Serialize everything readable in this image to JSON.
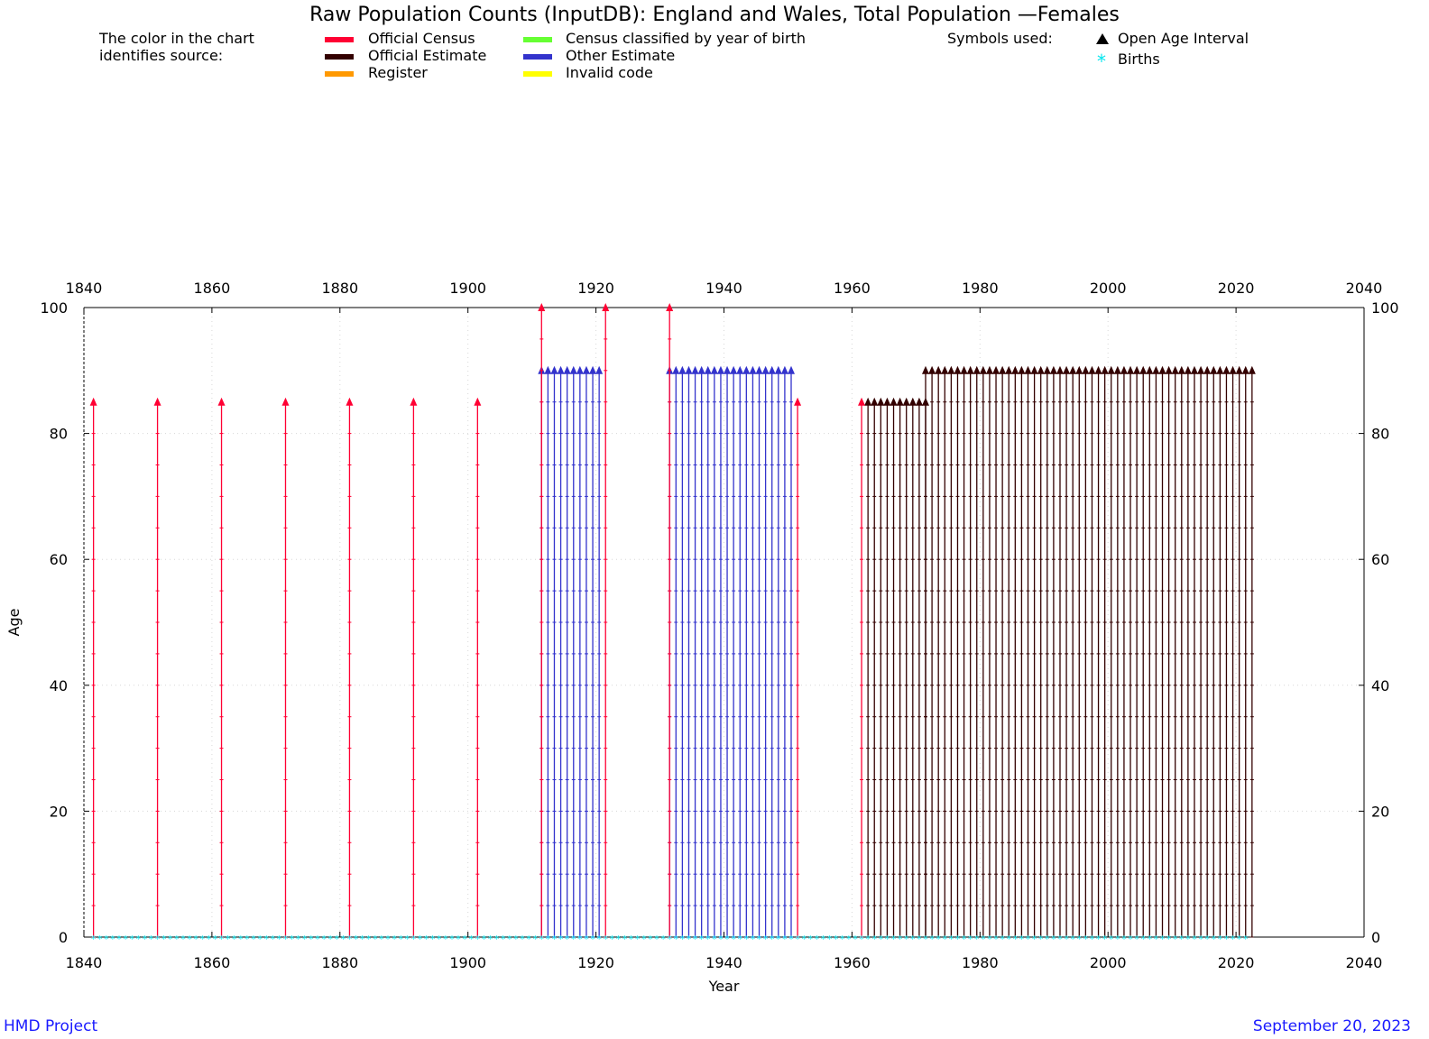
{
  "title": "Raw Population Counts (InputDB): England and Wales, Total Population  —Females",
  "legend": {
    "intro_line1": "The color in the chart",
    "intro_line2": "identifies source:",
    "sources": [
      {
        "label": "Official Census",
        "color": "#ff0033"
      },
      {
        "label": "Official Estimate",
        "color": "#330000"
      },
      {
        "label": "Register",
        "color": "#ff9900"
      },
      {
        "label": "Census classified by year of birth",
        "color": "#66ff33"
      },
      {
        "label": "Other Estimate",
        "color": "#3333cc"
      },
      {
        "label": "Invalid code",
        "color": "#ffff00"
      }
    ],
    "symbols_title": "Symbols used:",
    "open_age_label": "Open Age Interval",
    "births_label": "Births",
    "star_glyph": "*"
  },
  "footer": {
    "left": "HMD Project",
    "right": "September 20, 2023"
  },
  "chart_data": {
    "type": "scatter",
    "xlabel": "Year",
    "ylabel": "Age",
    "xlim": [
      1840,
      2040
    ],
    "ylim": [
      0,
      100
    ],
    "xticks": [
      1840,
      1860,
      1880,
      1900,
      1920,
      1940,
      1960,
      1980,
      2000,
      2020,
      2040
    ],
    "yticks": [
      0,
      20,
      40,
      60,
      80,
      100
    ],
    "grid": true,
    "series": [
      {
        "name": "Official Census",
        "color": "#ff0033",
        "years": [
          1841,
          1851,
          1861,
          1871,
          1881,
          1891,
          1901,
          1911,
          1921,
          1931,
          1951,
          1961
        ],
        "open_age": [
          85,
          85,
          85,
          85,
          85,
          85,
          85,
          100,
          100,
          100,
          85,
          85
        ]
      },
      {
        "name": "Other Estimate",
        "color": "#3333cc",
        "year_range": [
          1911,
          1920
        ],
        "extra_years": [
          1931,
          1932,
          1933,
          1934,
          1935,
          1936,
          1937,
          1938,
          1939,
          1940,
          1941,
          1942,
          1943,
          1944,
          1945,
          1946,
          1947,
          1948,
          1949,
          1950
        ],
        "open_age": 90
      },
      {
        "name": "Official Estimate",
        "color": "#330000",
        "segments": [
          {
            "from": 1962,
            "to": 1971,
            "open_age": 85
          },
          {
            "from": 1971,
            "to": 2022,
            "open_age": 90
          }
        ]
      },
      {
        "name": "Births",
        "color": "#00e5ee",
        "from": 1841,
        "to": 2021,
        "age": 0
      }
    ]
  }
}
